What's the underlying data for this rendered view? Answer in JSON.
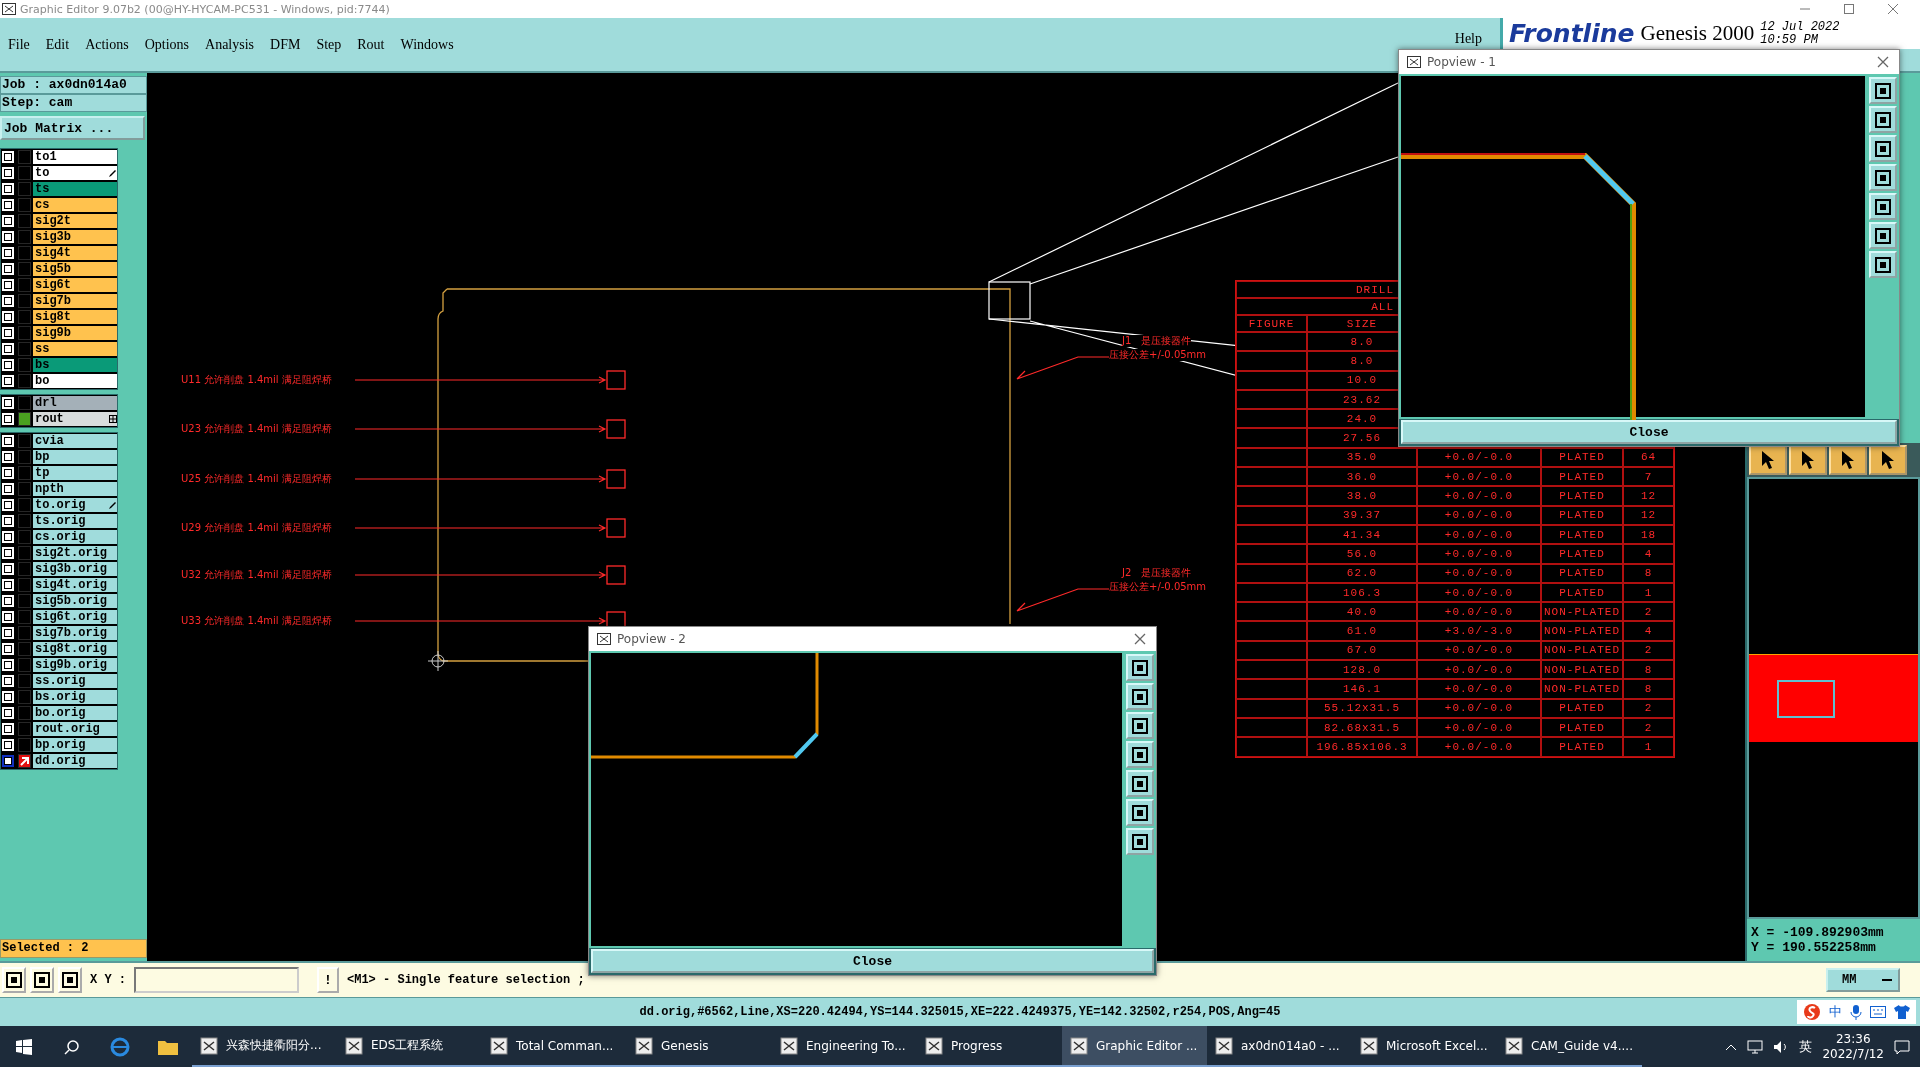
{
  "title_bar": {
    "title": "Graphic Editor 9.07b2 (00@HY-HYCAM-PC531 - Windows, pid:7744)"
  },
  "menu": [
    {
      "label": "File"
    },
    {
      "label": "Edit"
    },
    {
      "label": "Actions"
    },
    {
      "label": "Options"
    },
    {
      "label": "Analysis"
    },
    {
      "label": "DFM"
    },
    {
      "label": "Step"
    },
    {
      "label": "Rout"
    },
    {
      "label": "Windows"
    }
  ],
  "help": "Help",
  "logo": {
    "brand": "Frontline",
    "product": "Genesis 2000",
    "date": "12 Jul 2022",
    "time": "10:59 PM"
  },
  "job": {
    "job": "Job : ax0dn014a0",
    "step": "Step: cam",
    "matrix_button": "Job Matrix ..."
  },
  "layer_groups": [
    [
      {
        "name": "to1",
        "color": "#ffffff",
        "checked": false,
        "kind": "plain",
        "shown": false,
        "work": false
      },
      {
        "name": "to",
        "color": "#ffffff",
        "checked": false,
        "kind": "pen",
        "shown": false,
        "work": false
      },
      {
        "name": "ts",
        "color": "#0a9a78",
        "checked": false,
        "kind": "plain",
        "shown": false,
        "work": false
      },
      {
        "name": "cs",
        "color": "#ffc24e",
        "checked": false,
        "kind": "plain",
        "shown": false,
        "work": false
      },
      {
        "name": "sig2t",
        "color": "#ffc24e",
        "checked": false,
        "kind": "plain",
        "shown": false,
        "work": false
      },
      {
        "name": "sig3b",
        "color": "#ffc24e",
        "checked": false,
        "kind": "plain",
        "shown": false,
        "work": false
      },
      {
        "name": "sig4t",
        "color": "#ffc24e",
        "checked": false,
        "kind": "plain",
        "shown": false,
        "work": false
      },
      {
        "name": "sig5b",
        "color": "#ffc24e",
        "checked": false,
        "kind": "plain",
        "shown": false,
        "work": false
      },
      {
        "name": "sig6t",
        "color": "#ffc24e",
        "checked": false,
        "kind": "plain",
        "shown": false,
        "work": false
      },
      {
        "name": "sig7b",
        "color": "#ffc24e",
        "checked": false,
        "kind": "plain",
        "shown": false,
        "work": false
      },
      {
        "name": "sig8t",
        "color": "#ffc24e",
        "checked": false,
        "kind": "plain",
        "shown": false,
        "work": false
      },
      {
        "name": "sig9b",
        "color": "#ffc24e",
        "checked": false,
        "kind": "plain",
        "shown": false,
        "work": false
      },
      {
        "name": "ss",
        "color": "#ffc24e",
        "checked": false,
        "kind": "plain",
        "shown": false,
        "work": false
      },
      {
        "name": "bs",
        "color": "#0a9a78",
        "checked": false,
        "kind": "plain",
        "shown": false,
        "work": false
      },
      {
        "name": "bo",
        "color": "#ffffff",
        "checked": false,
        "kind": "plain",
        "shown": false,
        "work": false
      }
    ],
    [
      {
        "name": "drl",
        "color": "#a4b0b8",
        "checked": false,
        "kind": "plain",
        "shown": false,
        "work": false
      },
      {
        "name": "rout",
        "color": "#d8dcdc",
        "checked": false,
        "kind": "grid",
        "shown": true,
        "work": false
      }
    ],
    [
      {
        "name": "cvia",
        "color": "#a0dcdc",
        "checked": false,
        "kind": "plain",
        "shown": false,
        "work": false
      },
      {
        "name": "bp",
        "color": "#a0dcdc",
        "checked": false,
        "kind": "plain",
        "shown": false,
        "work": false
      },
      {
        "name": "tp",
        "color": "#a0dcdc",
        "checked": false,
        "kind": "plain",
        "shown": false,
        "work": false
      },
      {
        "name": "npth",
        "color": "#a0dcdc",
        "checked": false,
        "kind": "plain",
        "shown": false,
        "work": false
      },
      {
        "name": "to.orig",
        "color": "#a0dcdc",
        "checked": false,
        "kind": "pen",
        "shown": false,
        "work": false
      },
      {
        "name": "ts.orig",
        "color": "#a0dcdc",
        "checked": false,
        "kind": "plain",
        "shown": false,
        "work": false
      },
      {
        "name": "cs.orig",
        "color": "#a0dcdc",
        "checked": false,
        "kind": "plain",
        "shown": false,
        "work": false
      },
      {
        "name": "sig2t.orig",
        "color": "#a0dcdc",
        "checked": false,
        "kind": "plain",
        "shown": false,
        "work": false
      },
      {
        "name": "sig3b.orig",
        "color": "#a0dcdc",
        "checked": false,
        "kind": "plain",
        "shown": false,
        "work": false
      },
      {
        "name": "sig4t.orig",
        "color": "#a0dcdc",
        "checked": false,
        "kind": "plain",
        "shown": false,
        "work": false
      },
      {
        "name": "sig5b.orig",
        "color": "#a0dcdc",
        "checked": false,
        "kind": "plain",
        "shown": false,
        "work": false
      },
      {
        "name": "sig6t.orig",
        "color": "#a0dcdc",
        "checked": false,
        "kind": "plain",
        "shown": false,
        "work": false
      },
      {
        "name": "sig7b.orig",
        "color": "#a0dcdc",
        "checked": false,
        "kind": "plain",
        "shown": false,
        "work": false
      },
      {
        "name": "sig8t.orig",
        "color": "#a0dcdc",
        "checked": false,
        "kind": "plain",
        "shown": false,
        "work": false
      },
      {
        "name": "sig9b.orig",
        "color": "#a0dcdc",
        "checked": false,
        "kind": "plain",
        "shown": false,
        "work": false
      },
      {
        "name": "ss.orig",
        "color": "#a0dcdc",
        "checked": false,
        "kind": "plain",
        "shown": false,
        "work": false
      },
      {
        "name": "bs.orig",
        "color": "#a0dcdc",
        "checked": false,
        "kind": "plain",
        "shown": false,
        "work": false
      },
      {
        "name": "bo.orig",
        "color": "#a0dcdc",
        "checked": false,
        "kind": "plain",
        "shown": false,
        "work": false
      },
      {
        "name": "rout.orig",
        "color": "#a0dcdc",
        "checked": false,
        "kind": "plain",
        "shown": false,
        "work": false
      },
      {
        "name": "bp.orig",
        "color": "#a0dcdc",
        "checked": false,
        "kind": "plain",
        "shown": false,
        "work": false
      },
      {
        "name": "dd.orig",
        "color": "#a0dcdc",
        "checked": false,
        "kind": "plain",
        "shown": false,
        "work": true
      }
    ]
  ],
  "selected": "Selected : 2",
  "annotations": [
    {
      "text": "U11 允许削盘 1.4mil 满足阻焊桥"
    },
    {
      "text": "U23 允许削盘 1.4mil 满足阻焊桥"
    },
    {
      "text": "U25 允许削盘 1.4mil 满足阻焊桥"
    },
    {
      "text": "U29 允许削盘 1.4mil 满足阻焊桥"
    },
    {
      "text": "U32 允许削盘 1.4mil 满足阻焊桥"
    },
    {
      "text": "U33 允许削盘 1.4mil 满足阻焊桥"
    }
  ],
  "connector_notes": [
    {
      "title": "J1　是压接器件",
      "note": "压接公差+/-0.05mm"
    },
    {
      "title": "J2　是压接器件",
      "note": "压接公差+/-0.05mm"
    }
  ],
  "drill_table": {
    "title": "DRILL",
    "subtitle": "ALL",
    "columns": [
      "FIGURE",
      "SIZE"
    ],
    "rows": [
      {
        "size": "8.0"
      },
      {
        "size": "8.0"
      },
      {
        "size": "10.0"
      },
      {
        "size": "23.62"
      },
      {
        "size": "24.0"
      },
      {
        "size": "27.56"
      },
      {
        "size": "35.0",
        "tolerance": "+0.0/-0.0",
        "type": "PLATED",
        "count": "64"
      },
      {
        "size": "36.0",
        "tolerance": "+0.0/-0.0",
        "type": "PLATED",
        "count": "7"
      },
      {
        "size": "38.0",
        "tolerance": "+0.0/-0.0",
        "type": "PLATED",
        "count": "12"
      },
      {
        "size": "39.37",
        "tolerance": "+0.0/-0.0",
        "type": "PLATED",
        "count": "12"
      },
      {
        "size": "41.34",
        "tolerance": "+0.0/-0.0",
        "type": "PLATED",
        "count": "18"
      },
      {
        "size": "56.0",
        "tolerance": "+0.0/-0.0",
        "type": "PLATED",
        "count": "4"
      },
      {
        "size": "62.0",
        "tolerance": "+0.0/-0.0",
        "type": "PLATED",
        "count": "8"
      },
      {
        "size": "106.3",
        "tolerance": "+0.0/-0.0",
        "type": "PLATED",
        "count": "1"
      },
      {
        "size": "40.0",
        "tolerance": "+0.0/-0.0",
        "type": "NON-PLATED",
        "count": "2"
      },
      {
        "size": "61.0",
        "tolerance": "+3.0/-3.0",
        "type": "NON-PLATED",
        "count": "4"
      },
      {
        "size": "67.0",
        "tolerance": "+0.0/-0.0",
        "type": "NON-PLATED",
        "count": "2"
      },
      {
        "size": "128.0",
        "tolerance": "+0.0/-0.0",
        "type": "NON-PLATED",
        "count": "8"
      },
      {
        "size": "146.1",
        "tolerance": "+0.0/-0.0",
        "type": "NON-PLATED",
        "count": "8"
      },
      {
        "size": "55.12x31.5",
        "tolerance": "+0.0/-0.0",
        "type": "PLATED",
        "count": "2"
      },
      {
        "size": "82.68x31.5",
        "tolerance": "+0.0/-0.0",
        "type": "PLATED",
        "count": "2"
      },
      {
        "size": "196.85x106.3",
        "tolerance": "+0.0/-0.0",
        "type": "PLATED",
        "count": "1"
      }
    ]
  },
  "popviews": [
    {
      "title": "Popview - 1",
      "close": "Close"
    },
    {
      "title": "Popview - 2",
      "close": "Close"
    }
  ],
  "coords": {
    "x": "X = -109.892903mm",
    "y": "Y = 190.552258mm"
  },
  "command_bar": {
    "xy_label": "X Y :",
    "bang": "!",
    "prompt": "<M1> - Single feature selection ;",
    "units": "MM"
  },
  "status_line": "dd.orig,#6562,Line,XS=220.42494,YS=144.325015,XE=222.4249375,YE=142.32502,r254,POS,Ang=45",
  "ime": {
    "mode": "中"
  },
  "taskbar": {
    "apps": [
      {
        "label": "兴森快捷衢阳分...",
        "selected": false
      },
      {
        "label": "EDS工程系统",
        "selected": false
      },
      {
        "label": "Total Comman...",
        "selected": false
      },
      {
        "label": "Genesis",
        "selected": false
      },
      {
        "label": "Engineering To...",
        "selected": false
      },
      {
        "label": "Progress",
        "selected": false
      },
      {
        "label": "Graphic Editor ...",
        "selected": true
      },
      {
        "label": "ax0dn014a0 - ...",
        "selected": false
      },
      {
        "label": "Microsoft Excel...",
        "selected": false
      },
      {
        "label": "CAM_Guide v4....",
        "selected": false
      }
    ],
    "input_lang": "英",
    "time": "23:36",
    "date": "2022/7/12"
  }
}
